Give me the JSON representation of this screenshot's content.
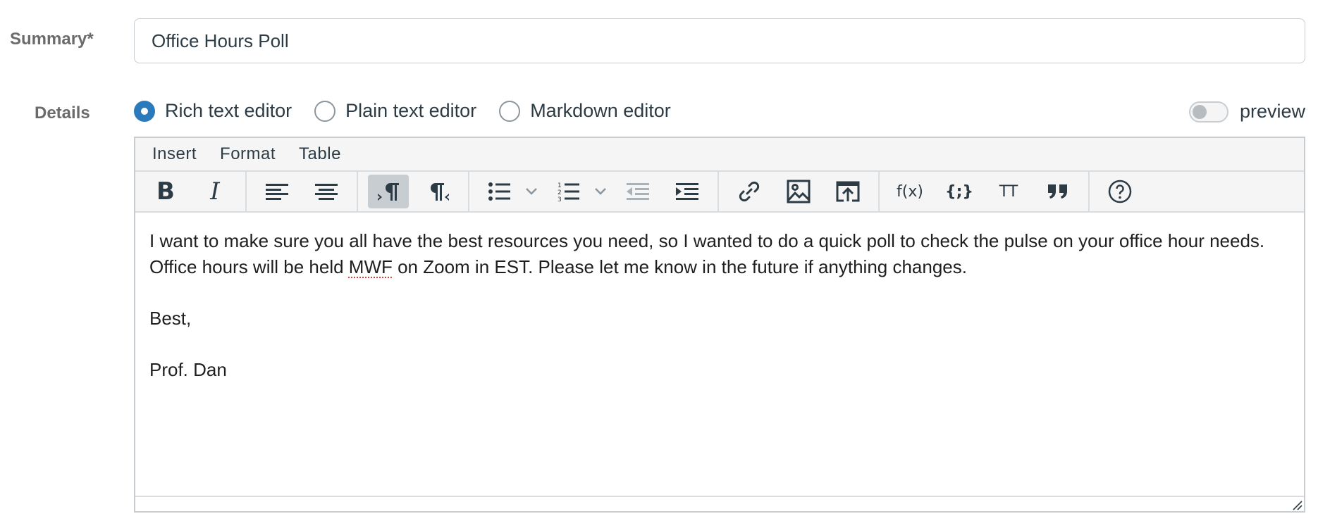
{
  "summary": {
    "label": "Summary*",
    "value": "Office Hours Poll"
  },
  "details": {
    "label": "Details",
    "editor_options": [
      {
        "label": "Rich text editor",
        "selected": true
      },
      {
        "label": "Plain text editor",
        "selected": false
      },
      {
        "label": "Markdown editor",
        "selected": false
      }
    ],
    "preview_label": "preview"
  },
  "editor": {
    "menu": [
      "Insert",
      "Format",
      "Table"
    ],
    "toolbar": {
      "bold": "B",
      "italic": "I",
      "math": "f(x)",
      "embed": "{;}",
      "font_size": "TT"
    },
    "body": {
      "paragraph1_a": "I want to make sure you all have the best resources you need, so I wanted to do a quick poll to check the pulse on your office hour needs. Office hours will be held ",
      "misspelled": "MWF",
      "paragraph1_b": " on Zoom in EST. Please let me know in the future if anything changes.",
      "closing": "Best,",
      "signature": "Prof. Dan"
    }
  },
  "colors": {
    "accent": "#2b7abc",
    "border": "#c7cdd1",
    "toolbar_bg": "#f5f5f5"
  }
}
